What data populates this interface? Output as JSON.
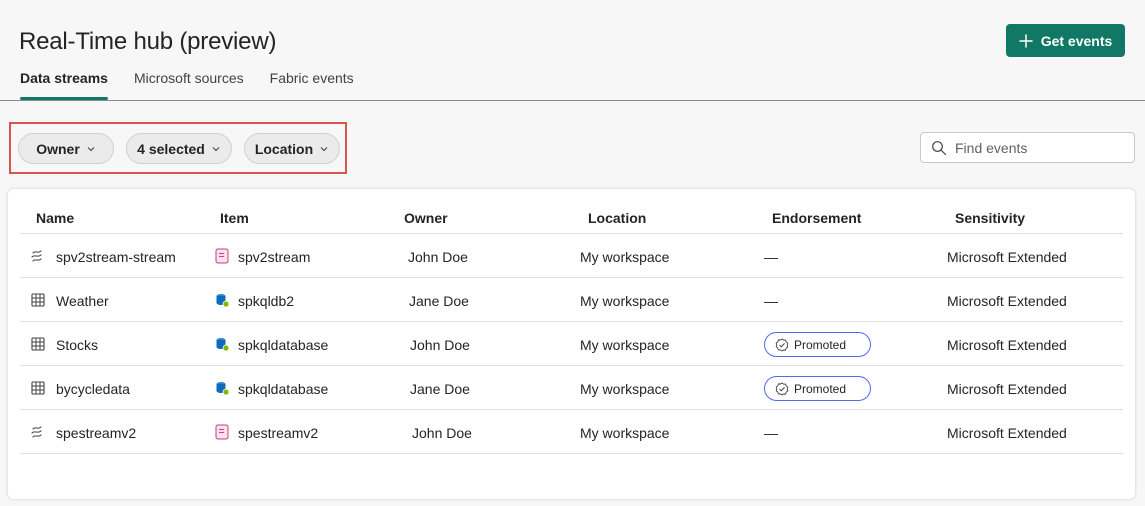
{
  "page": {
    "title": "Real-Time hub (preview)"
  },
  "header": {
    "get_events_label": "Get events"
  },
  "tabs": [
    {
      "label": "Data streams",
      "active": true
    },
    {
      "label": "Microsoft sources",
      "active": false
    },
    {
      "label": "Fabric events",
      "active": false
    }
  ],
  "filters": [
    {
      "label": "Owner"
    },
    {
      "label": "4 selected"
    },
    {
      "label": "Location"
    }
  ],
  "search": {
    "placeholder": "Find events",
    "value": ""
  },
  "table": {
    "columns": [
      "Name",
      "Item",
      "Owner",
      "Location",
      "Endorsement",
      "Sensitivity"
    ],
    "rows": [
      {
        "name": "spv2stream-stream",
        "name_icon": "stream-icon",
        "item": "spv2stream",
        "item_icon": "eventstream-item-icon",
        "owner": "John Doe",
        "location": "My workspace",
        "endorsement": "—",
        "sensitivity": "Microsoft Extended"
      },
      {
        "name": "Weather",
        "name_icon": "table-icon",
        "item": "spkqldb2",
        "item_icon": "kql-database-icon",
        "owner": "Jane Doe",
        "location": "My workspace",
        "endorsement": "—",
        "sensitivity": "Microsoft Extended"
      },
      {
        "name": "Stocks",
        "name_icon": "table-icon",
        "item": "spkqldatabase",
        "item_icon": "kql-database-icon",
        "owner": "John Doe",
        "location": "My workspace",
        "endorsement": "Promoted",
        "sensitivity": "Microsoft Extended"
      },
      {
        "name": "bycycledata",
        "name_icon": "table-icon",
        "item": "spkqldatabase",
        "item_icon": "kql-database-icon",
        "owner": "Jane Doe",
        "location": "My workspace",
        "endorsement": "Promoted",
        "sensitivity": "Microsoft Extended"
      },
      {
        "name": "spestreamv2",
        "name_icon": "stream-icon",
        "item": "spestreamv2",
        "item_icon": "eventstream-item-icon",
        "owner": "John Doe",
        "location": "My workspace",
        "endorsement": "—",
        "sensitivity": "Microsoft Extended"
      }
    ]
  },
  "colors": {
    "accent": "#117865",
    "highlight_frame": "#d9534f",
    "badge_border": "#4f6bed"
  }
}
